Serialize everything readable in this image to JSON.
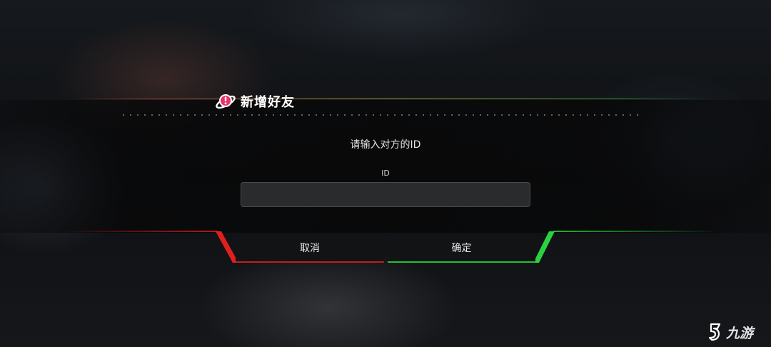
{
  "dialog": {
    "title": "新增好友",
    "prompt": "请输入对方的ID",
    "field_label": "ID",
    "input_value": "",
    "input_placeholder": ""
  },
  "buttons": {
    "cancel_label": "取消",
    "confirm_label": "确定"
  },
  "watermark": {
    "text": "九游"
  },
  "colors": {
    "cancel_accent": "#c01f1f",
    "confirm_accent": "#22c23a",
    "icon_pink": "#e8336a"
  },
  "icons": {
    "title": "planet-alert-icon",
    "watermark": "jiuyou-logo-icon"
  }
}
